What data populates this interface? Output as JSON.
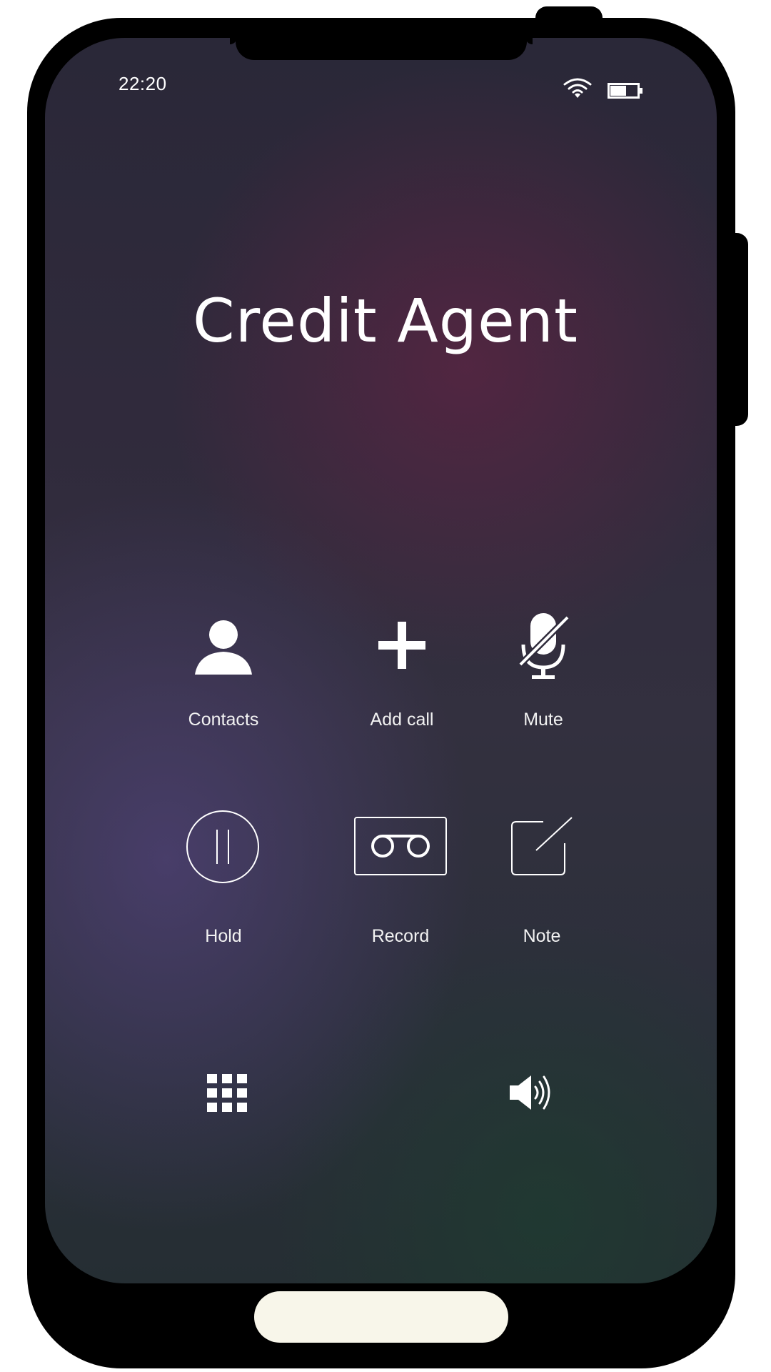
{
  "status_bar": {
    "time": "22:20",
    "wifi_icon": "wifi-icon",
    "battery_icon": "battery-icon"
  },
  "call": {
    "contact_name": "Credit Agent"
  },
  "controls": [
    {
      "id": "contacts",
      "label": "Contacts",
      "icon": "person-icon"
    },
    {
      "id": "add-call",
      "label": "Add call",
      "icon": "plus-icon"
    },
    {
      "id": "mute",
      "label": "Mute",
      "icon": "microphone-muted-icon"
    },
    {
      "id": "hold",
      "label": "Hold",
      "icon": "pause-icon"
    },
    {
      "id": "record",
      "label": "Record",
      "icon": "voicemail-tape-icon"
    },
    {
      "id": "note",
      "label": "Note",
      "icon": "edit-note-icon"
    }
  ],
  "bottom_controls": [
    {
      "id": "keypad",
      "icon": "keypad-grid-icon"
    },
    {
      "id": "speaker",
      "icon": "speaker-volume-icon"
    }
  ],
  "colors": {
    "phone_frame": "#000000",
    "text": "#ffffff",
    "home_pill": "#f8f6ea"
  }
}
